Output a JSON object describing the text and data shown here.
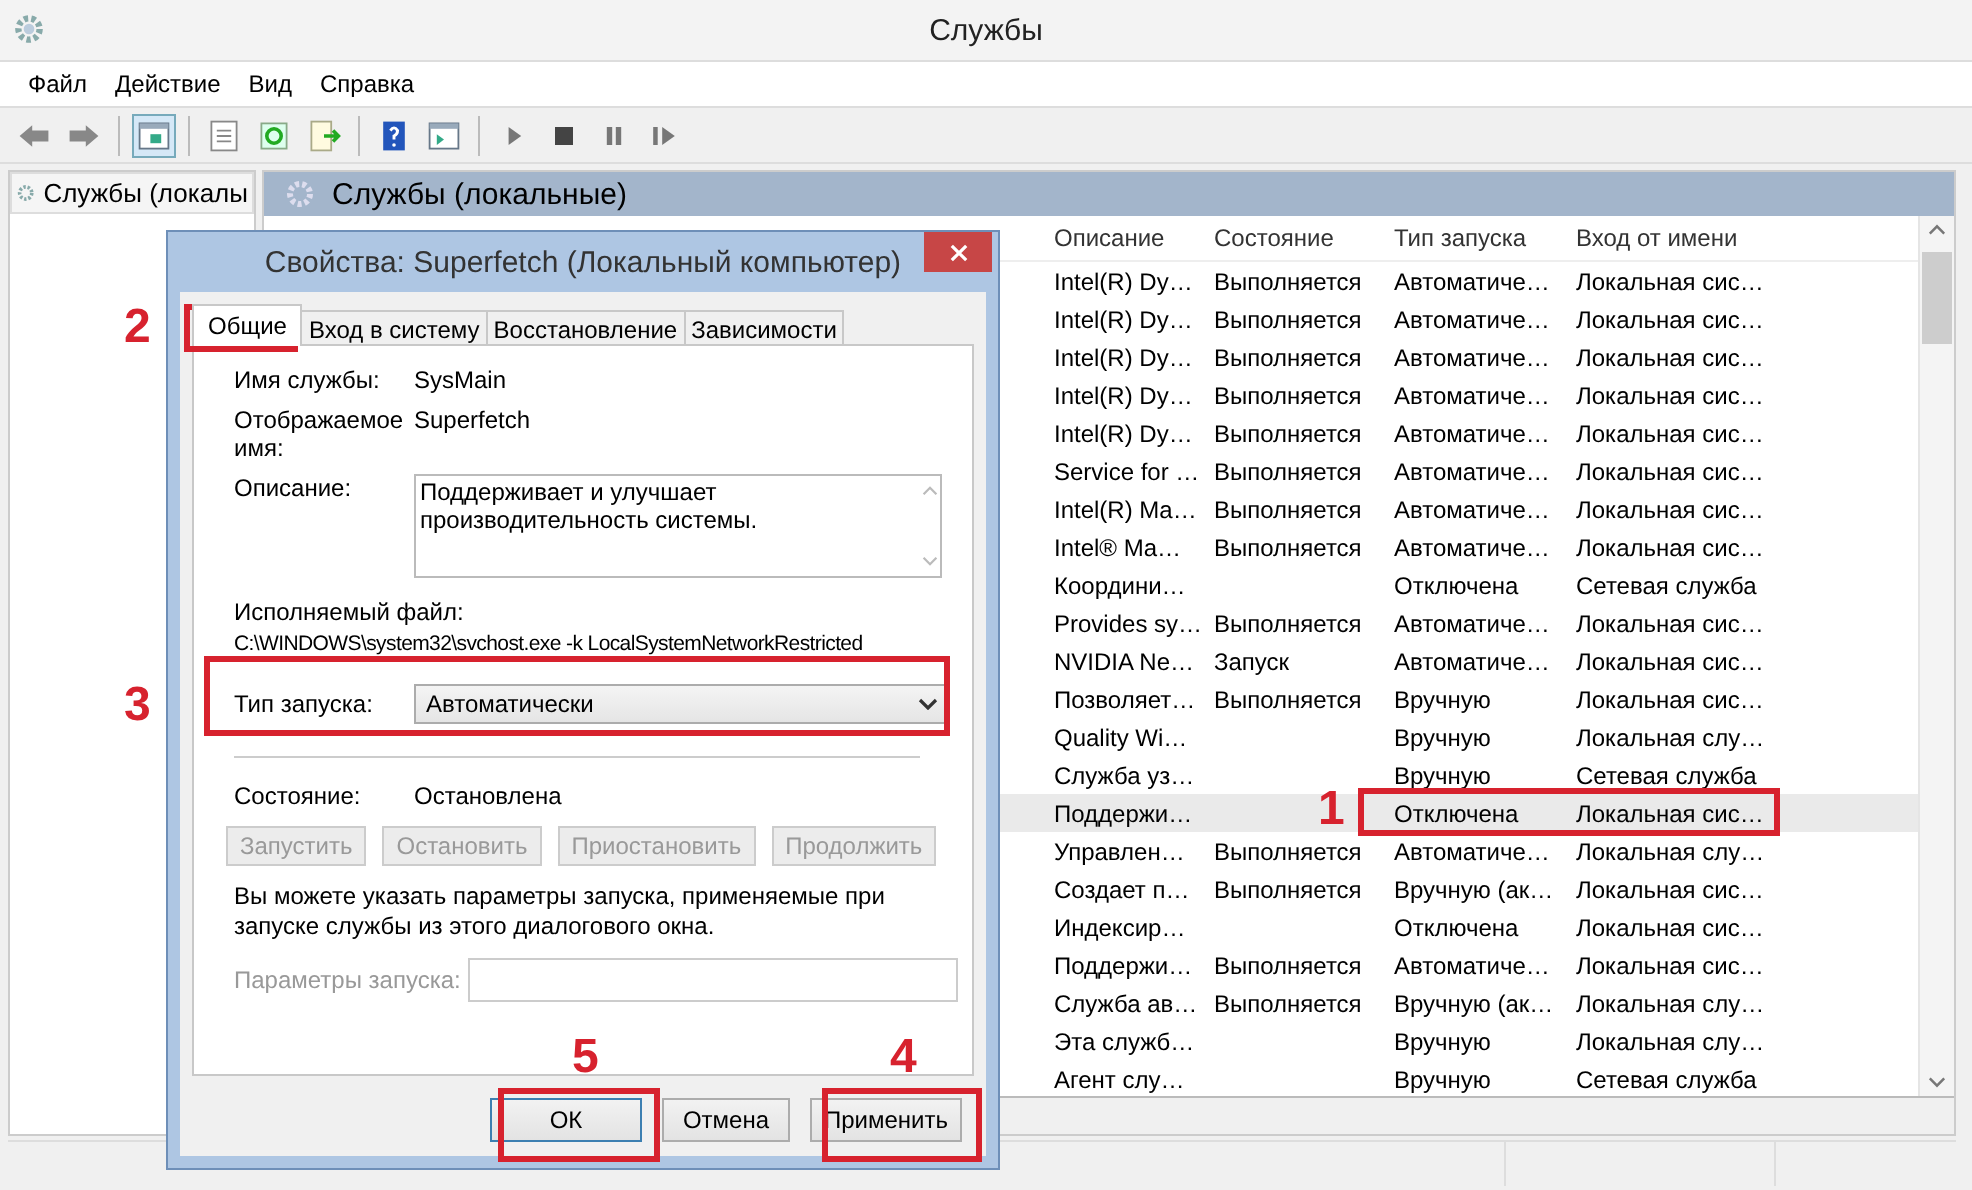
{
  "window": {
    "title": "Службы"
  },
  "menu": [
    "Файл",
    "Действие",
    "Вид",
    "Справка"
  ],
  "toolbar": [
    {
      "kind": "back",
      "selected": false
    },
    {
      "kind": "forward",
      "selected": false
    },
    {
      "kind": "sep"
    },
    {
      "kind": "tree",
      "selected": true
    },
    {
      "kind": "sep"
    },
    {
      "kind": "props",
      "selected": false
    },
    {
      "kind": "refresh",
      "selected": false
    },
    {
      "kind": "export",
      "selected": false
    },
    {
      "kind": "sep"
    },
    {
      "kind": "help",
      "selected": false
    },
    {
      "kind": "view",
      "selected": false
    },
    {
      "kind": "sep"
    },
    {
      "kind": "play",
      "selected": false
    },
    {
      "kind": "stop",
      "selected": false
    },
    {
      "kind": "pause",
      "selected": false
    },
    {
      "kind": "resume",
      "selected": false
    }
  ],
  "tree": {
    "items": [
      {
        "label": "Службы (локалы",
        "selected": true
      }
    ]
  },
  "pane_title": "Службы (локальные)",
  "table": {
    "columns": [
      "Описание",
      "Состояние",
      "Тип запуска",
      "Вход от имени"
    ],
    "rows": [
      {
        "cells": [
          "Intel(R) Dy…",
          "Выполняется",
          "Автоматиче…",
          "Локальная сис…"
        ],
        "selected": false
      },
      {
        "cells": [
          "Intel(R) Dy…",
          "Выполняется",
          "Автоматиче…",
          "Локальная сис…"
        ],
        "selected": false
      },
      {
        "cells": [
          "Intel(R) Dy…",
          "Выполняется",
          "Автоматиче…",
          "Локальная сис…"
        ],
        "selected": false
      },
      {
        "cells": [
          "Intel(R) Dy…",
          "Выполняется",
          "Автоматиче…",
          "Локальная сис…"
        ],
        "selected": false
      },
      {
        "cells": [
          "Intel(R) Dy…",
          "Выполняется",
          "Автоматиче…",
          "Локальная сис…"
        ],
        "selected": false
      },
      {
        "cells": [
          "Service for …",
          "Выполняется",
          "Автоматиче…",
          "Локальная сис…"
        ],
        "selected": false
      },
      {
        "cells": [
          "Intel(R) Ma…",
          "Выполняется",
          "Автоматиче…",
          "Локальная сис…"
        ],
        "selected": false
      },
      {
        "cells": [
          "Intel® Ma…",
          "Выполняется",
          "Автоматиче…",
          "Локальная сис…"
        ],
        "selected": false
      },
      {
        "cells": [
          "Координи…",
          "",
          "Отключена",
          "Сетевая служба"
        ],
        "selected": false
      },
      {
        "cells": [
          "Provides sy…",
          "Выполняется",
          "Автоматиче…",
          "Локальная сис…"
        ],
        "selected": false
      },
      {
        "cells": [
          "NVIDIA Ne…",
          "Запуск",
          "Автоматиче…",
          "Локальная сис…"
        ],
        "selected": false
      },
      {
        "cells": [
          "Позволяет…",
          "Выполняется",
          "Вручную",
          "Локальная сис…"
        ],
        "selected": false
      },
      {
        "cells": [
          "Quality Wi…",
          "",
          "Вручную",
          "Локальная слу…"
        ],
        "selected": false
      },
      {
        "cells": [
          "Служба уз…",
          "",
          "Вручную",
          "Сетевая служба"
        ],
        "selected": false
      },
      {
        "cells": [
          "Поддержи…",
          "",
          "Отключена",
          "Локальная сис…"
        ],
        "selected": true,
        "callout": "1"
      },
      {
        "cells": [
          "Управлен…",
          "Выполняется",
          "Автоматиче…",
          "Локальная слу…"
        ],
        "selected": false
      },
      {
        "cells": [
          "Создает п…",
          "Выполняется",
          "Вручную (ак…",
          "Локальная сис…"
        ],
        "selected": false
      },
      {
        "cells": [
          "Индексир…",
          "",
          "Отключена",
          "Локальная сис…"
        ],
        "selected": false
      },
      {
        "cells": [
          "Поддержи…",
          "Выполняется",
          "Автоматиче…",
          "Локальная сис…"
        ],
        "selected": false
      },
      {
        "cells": [
          "Служба ав…",
          "Выполняется",
          "Вручную (ак…",
          "Локальная слу…"
        ],
        "selected": false
      },
      {
        "cells": [
          "Эта служб…",
          "",
          "Вручную",
          "Локальная слу…"
        ],
        "selected": false
      },
      {
        "cells": [
          "Агент слу…",
          "",
          "Вручную",
          "Сетевая служба"
        ],
        "selected": false
      }
    ]
  },
  "dialog": {
    "title": "Свойства: Superfetch (Локальный компьютер)",
    "tabs": [
      {
        "label": "Общие",
        "selected": true
      },
      {
        "label": "Вход в систему",
        "selected": false
      },
      {
        "label": "Восстановление",
        "selected": false
      },
      {
        "label": "Зависимости",
        "selected": false
      }
    ],
    "service_name": {
      "label": "Имя службы:",
      "value": "SysMain"
    },
    "display_name": {
      "label": "Отображаемое имя:",
      "value": "Superfetch"
    },
    "description": {
      "label": "Описание:",
      "value": "Поддерживает и улучшает производительность системы."
    },
    "executable": {
      "label": "Исполняемый файл:",
      "value": "C:\\WINDOWS\\system32\\svchost.exe -k LocalSystemNetworkRestricted"
    },
    "startup_type": {
      "label": "Тип запуска:",
      "value": "Автоматически"
    },
    "status": {
      "label": "Состояние:",
      "value": "Остановлена"
    },
    "service_buttons": [
      {
        "label": "Запустить",
        "disabled": true
      },
      {
        "label": "Остановить",
        "disabled": true
      },
      {
        "label": "Приостановить",
        "disabled": true
      },
      {
        "label": "Продолжить",
        "disabled": true
      }
    ],
    "hint": "Вы можете указать параметры запуска, применяемые при запуске службы из этого диалогового окна.",
    "start_params": {
      "label": "Параметры запуска:",
      "disabled": true
    },
    "buttons": [
      {
        "label": "ОК",
        "default": true
      },
      {
        "label": "Отмена",
        "default": false
      },
      {
        "label": "Применить",
        "default": false
      }
    ]
  },
  "annotations": [
    {
      "label": "2"
    },
    {
      "label": "3"
    },
    {
      "label": "4"
    },
    {
      "label": "5"
    }
  ]
}
